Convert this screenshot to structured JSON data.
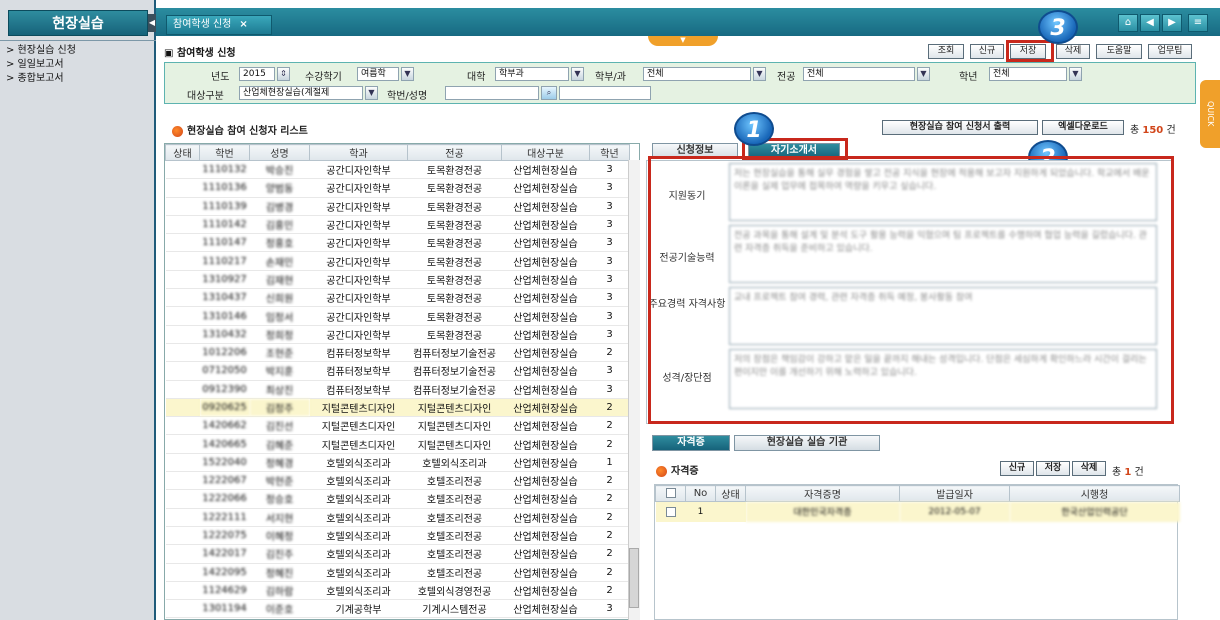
{
  "app": {
    "nav_title": "현장실습"
  },
  "leftnav": {
    "items": [
      "> 현장실습 신청",
      "> 일일보고서",
      "> 종합보고서"
    ]
  },
  "tab": {
    "label": "참여학생 신청"
  },
  "header": {
    "title": "참여학생 신청"
  },
  "toolbar": {
    "search": "조회",
    "new": "신규",
    "save": "저장",
    "delete": "삭제",
    "help": "도움말",
    "guide": "업무팁"
  },
  "filter": {
    "year_label": "년도",
    "year_value": "2015",
    "semester_label": "수강학기",
    "semester_value": "여름학",
    "college_label": "대학",
    "college_value": "학부과",
    "dept_label": "학부/과",
    "dept_value": "전체",
    "major_label": "전공",
    "major_value": "전체",
    "grade_label": "학년",
    "grade_value": "전체",
    "target_label": "대상구분",
    "target_value": "산업체현장실습(계절제",
    "student_label": "학번/성명",
    "student_value": ""
  },
  "list": {
    "title": "현장실습 참여 신청자 리스트",
    "print_button": "현장실습 참여 신청서 출력",
    "excel_button": "엑셀다운로드",
    "total_prefix": "총",
    "total": "150",
    "total_suffix": "건",
    "columns": [
      "상태",
      "학번",
      "성명",
      "학과",
      "전공",
      "대상구분",
      "학년"
    ],
    "rows": [
      [
        "",
        "1110132",
        "박승진",
        "공간디자인학부",
        "토목환경전공",
        "산업체현장실습",
        "3"
      ],
      [
        "",
        "1110136",
        "양범동",
        "공간디자인학부",
        "토목환경전공",
        "산업체현장실습",
        "3"
      ],
      [
        "",
        "1110139",
        "김병경",
        "공간디자인학부",
        "토목환경전공",
        "산업체현장실습",
        "3"
      ],
      [
        "",
        "1110142",
        "김홍민",
        "공간디자인학부",
        "토목환경전공",
        "산업체현장실습",
        "3"
      ],
      [
        "",
        "1110147",
        "정홍호",
        "공간디자인학부",
        "토목환경전공",
        "산업체현장실습",
        "3"
      ],
      [
        "",
        "1110217",
        "손재민",
        "공간디자인학부",
        "토목환경전공",
        "산업체현장실습",
        "3"
      ],
      [
        "",
        "1310927",
        "김재현",
        "공간디자인학부",
        "토목환경전공",
        "산업체현장실습",
        "3"
      ],
      [
        "",
        "1310437",
        "신희원",
        "공간디자인학부",
        "토목환경전공",
        "산업체현장실습",
        "3"
      ],
      [
        "",
        "1310146",
        "임정서",
        "공간디자인학부",
        "토목환경전공",
        "산업체현장실습",
        "3"
      ],
      [
        "",
        "1310432",
        "정희정",
        "공간디자인학부",
        "토목환경전공",
        "산업체현장실습",
        "3"
      ],
      [
        "",
        "1012206",
        "조현준",
        "컴퓨터정보학부",
        "컴퓨터정보기술전공",
        "산업체현장실습",
        "2"
      ],
      [
        "",
        "0712050",
        "박지훈",
        "컴퓨터정보학부",
        "컴퓨터정보기술전공",
        "산업체현장실습",
        "3"
      ],
      [
        "",
        "0912390",
        "최상진",
        "컴퓨터정보학부",
        "컴퓨터정보기술전공",
        "산업체현장실습",
        "3"
      ],
      [
        "",
        "0920625",
        "김정주",
        "지털콘텐츠디자인",
        "지털콘텐츠디자인",
        "산업체현장실습",
        "2"
      ],
      [
        "",
        "1420662",
        "김진선",
        "지털콘텐츠디자인",
        "지털콘텐츠디자인",
        "산업체현장실습",
        "2"
      ],
      [
        "",
        "1420665",
        "김혜준",
        "지털콘텐츠디자인",
        "지털콘텐츠디자인",
        "산업체현장실습",
        "2"
      ],
      [
        "",
        "1522040",
        "정혜경",
        "호텔외식조리과",
        "호텔외식조리과",
        "산업체현장실습",
        "1"
      ],
      [
        "",
        "1222067",
        "박현준",
        "호텔외식조리과",
        "호텔조리전공",
        "산업체현장실습",
        "2"
      ],
      [
        "",
        "1222066",
        "정승호",
        "호텔외식조리과",
        "호텔조리전공",
        "산업체현장실습",
        "2"
      ],
      [
        "",
        "1222111",
        "서지현",
        "호텔외식조리과",
        "호텔조리전공",
        "산업체현장실습",
        "2"
      ],
      [
        "",
        "1222075",
        "이혜정",
        "호텔외식조리과",
        "호텔조리전공",
        "산업체현장실습",
        "2"
      ],
      [
        "",
        "1422017",
        "김진주",
        "호텔외식조리과",
        "호텔조리전공",
        "산업체현장실습",
        "2"
      ],
      [
        "",
        "1422095",
        "정혜진",
        "호텔외식조리과",
        "호텔조리전공",
        "산업체현장실습",
        "2"
      ],
      [
        "",
        "1124629",
        "김하람",
        "호텔외식조리과",
        "호텔외식경영전공",
        "산업체현장실습",
        "2"
      ],
      [
        "",
        "1301194",
        "이준호",
        "기계공학부",
        "기계시스템전공",
        "산업체현장실습",
        "3"
      ]
    ]
  },
  "detail": {
    "tab_apply": "신청정보",
    "tab_intro": "자기소개서",
    "fields": [
      {
        "label": "지원동기",
        "text": "저는 현장실습을 통해 실무 경험을 쌓고 전공 지식을 현장에 적용해 보고자 지원하게 되었습니다. 학교에서 배운 이론을 실제 업무에 접목하여 역량을 키우고 싶습니다."
      },
      {
        "label": "전공기술능력",
        "text": "전공 과목을 통해 설계 및 분석 도구 활용 능력을 익혔으며 팀 프로젝트를 수행하며 협업 능력을 길렀습니다. 관련 자격증 취득을 준비하고 있습니다."
      },
      {
        "label": "주요경력 자격사항",
        "text": "교내 프로젝트 참여 경력, 관련 자격증 취득 예정, 봉사활동 참여"
      },
      {
        "label": "성격/장단점",
        "text": "저의 장점은 책임감이 강하고 맡은 일을 끝까지 해내는 성격입니다. 단점은 세심하게 확인하느라 시간이 걸리는 편이지만 이를 개선하기 위해 노력하고 있습니다."
      }
    ]
  },
  "lower": {
    "tab_cert": "자격증",
    "tab_org": "현장실습 실습 기관",
    "title": "자격증",
    "new": "신규",
    "save": "저장",
    "delete": "삭제",
    "total_prefix": "총",
    "total": "1",
    "total_suffix": "건",
    "columns": [
      "",
      "No",
      "상태",
      "자격증명",
      "발급일자",
      "시행청"
    ],
    "rows": [
      [
        "",
        "1",
        "",
        "대한민국자격증",
        "2012-05-07",
        "한국산업인력공단"
      ]
    ]
  },
  "badges": [
    "1",
    "2",
    "3"
  ],
  "quick": "QUICK",
  "colors": {
    "accent": "#1d7a92",
    "highlight": "#c8281c",
    "selected_row": "#fbf6cd"
  }
}
